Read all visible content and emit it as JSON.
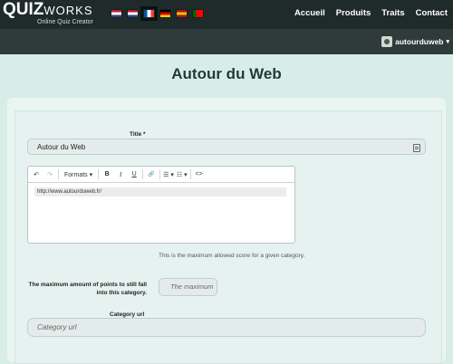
{
  "header": {
    "logo_main": "QUIZ",
    "logo_works": "WORKS",
    "logo_subtitle": "Online Quiz Creator",
    "flags": [
      {
        "name": "flag-us-icon",
        "colors": [
          "#b22234",
          "#ffffff",
          "#3c3b6e"
        ]
      },
      {
        "name": "flag-nl-icon",
        "colors": [
          "#ae1c28",
          "#ffffff",
          "#21468b"
        ]
      },
      {
        "name": "flag-fr-icon",
        "colors": [
          "#0055a4",
          "#ffffff",
          "#ef4135"
        ]
      },
      {
        "name": "flag-de-icon",
        "colors": [
          "#000000",
          "#dd0000",
          "#ffce00"
        ]
      },
      {
        "name": "flag-es-icon",
        "colors": [
          "#aa151b",
          "#f1bf00",
          "#aa151b"
        ]
      },
      {
        "name": "flag-pt-icon",
        "colors": [
          "#006600",
          "#ff0000",
          "#ff0000"
        ]
      }
    ],
    "nav": [
      "Accueil",
      "Produits",
      "Traits",
      "Contact"
    ]
  },
  "userbar": {
    "username": "autourduweb",
    "chevron": "▾"
  },
  "page": {
    "title": "Autour du Web"
  },
  "form": {
    "title_label": "Title *",
    "title_value": "Autour du Web",
    "editor": {
      "undo": "↶",
      "redo": "↷",
      "formats": "Formats ▾",
      "bold": "B",
      "italic": "I",
      "underline": "U",
      "link": "🔗",
      "bullet_list": "☰ ▾",
      "numbered_list": "☷ ▾",
      "code": "<>",
      "content": "http://www.autourduweb.fr/"
    },
    "help_text": "This is the maximum allowed score for a given category.",
    "max_points_label": "The maximum amount of points to still fall into this category.",
    "max_points_placeholder": "The maximum",
    "category_url_label": "Category url",
    "category_url_placeholder": "Category url"
  },
  "colors": {
    "topbar": "#1f2b2b",
    "userbar": "#2f3a3a",
    "background": "#d9ede8",
    "title": "#1f3a3a"
  }
}
